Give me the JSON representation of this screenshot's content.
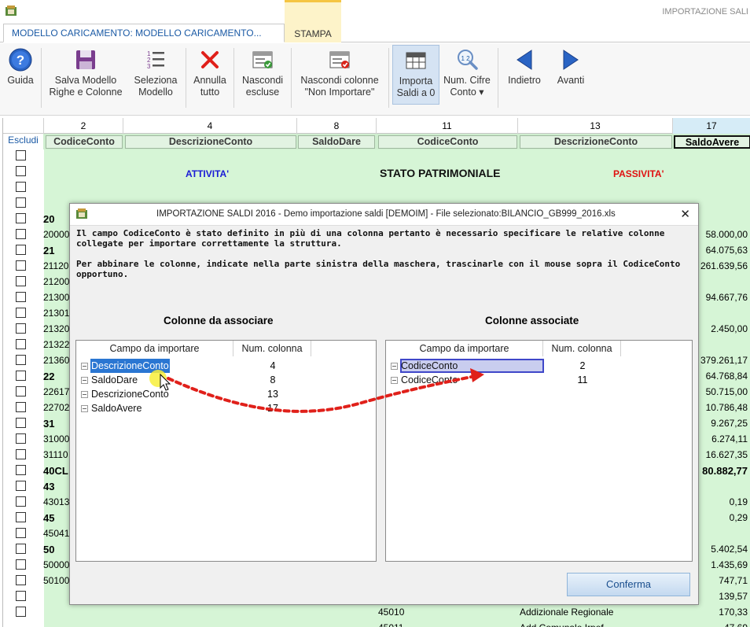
{
  "window": {
    "title": "IMPORTAZIONE SALI"
  },
  "tabs": [
    {
      "label": "MODELLO CARICAMENTO: MODELLO CARICAMENTO..."
    },
    {
      "label": "STAMPA"
    }
  ],
  "ribbon": {
    "buttons": [
      {
        "label": "Guida",
        "icon": "help-icon"
      },
      {
        "label": "Salva Modello\nRighe e Colonne",
        "icon": "save-icon"
      },
      {
        "label": "Seleziona\nModello",
        "icon": "list-icon"
      },
      {
        "label": "Annulla\ntutto",
        "icon": "cancel-icon"
      },
      {
        "label": "Nascondi\nescluse",
        "icon": "hide-icon"
      },
      {
        "label": "Nascondi colonne\n\"Non Importare\"",
        "icon": "hide-columns-icon"
      },
      {
        "label": "Importa\nSaldi a 0",
        "icon": "table-icon"
      },
      {
        "label": "Num. Cifre\nConto ▾",
        "icon": "zoom-icon"
      },
      {
        "label": "Indietro",
        "icon": "arrow-left-icon"
      },
      {
        "label": "Avanti",
        "icon": "arrow-right-icon"
      }
    ]
  },
  "grid": {
    "escludi_label": "Escludi",
    "column_numbers": [
      "2",
      "4",
      "8",
      "11",
      "13",
      "17"
    ],
    "column_names": [
      "CodiceConto",
      "DescrizioneConto",
      "SaldoDare",
      "CodiceConto",
      "DescrizioneConto",
      "SaldoAvere"
    ],
    "banner": {
      "attivita": "ATTIVITA'",
      "stato": "STATO PATRIMONIALE",
      "passivita": "PASSIVITA'"
    },
    "row_codes": [
      "20",
      "20000",
      "21",
      "21120",
      "21200",
      "21300",
      "21301",
      "21320",
      "21322",
      "21360",
      "22",
      "22617",
      "22702",
      "31",
      "31000",
      "31110",
      "40CL",
      "43",
      "43013",
      "45",
      "45041",
      "50",
      "50000",
      "50100"
    ],
    "row_values": [
      "58.000,00",
      "64.075,63",
      "261.639,56",
      "94.667,76",
      "2.450,00",
      "379.261,17",
      "64.768,84",
      "50.715,00",
      "10.786,48",
      "9.267,25",
      "6.274,11",
      "16.627,35",
      "80.882,77",
      "0,19",
      "0,29",
      "5.402,54",
      "1.435,69",
      "747,71",
      "139,57",
      "170,33",
      "47,69"
    ],
    "bottom_row": {
      "code": "45010",
      "description": "Addizionale Regionale",
      "value": "170,33"
    },
    "last_row": {
      "code": "45011",
      "description": "Add.Comunale Irpef"
    }
  },
  "dialog": {
    "title": "IMPORTAZIONE SALDI 2016 - Demo importazione saldi [DEMOIM] - File selezionato:BILANCIO_GB999_2016.xls",
    "close_glyph": "✕",
    "message_1a": "Il campo CodiceConto è stato definito in più di una colonna pertanto è necessario specificare le relative colonne",
    "message_1b": "collegate per importare correttamente la struttura.",
    "message_2a": "Per abbinare le colonne, indicate nella parte sinistra della maschera,  trascinarle con il mouse sopra il CodiceConto",
    "message_2b": "opportuno.",
    "left_title": "Colonne da associare",
    "right_title": "Colonne associate",
    "hdr_field": "Campo da importare",
    "hdr_col": "Num. colonna",
    "left_rows": [
      {
        "field": "DescrizioneConto",
        "col": "4"
      },
      {
        "field": "SaldoDare",
        "col": "8"
      },
      {
        "field": "DescrizioneConto",
        "col": "13"
      },
      {
        "field": "SaldoAvere",
        "col": "17"
      }
    ],
    "right_rows": [
      {
        "field": "CodiceConto",
        "col": "2"
      },
      {
        "field": "CodiceConto",
        "col": "11"
      }
    ],
    "confirm_label": "Conferma"
  },
  "colors": {
    "accent": "#1b5aa5",
    "grid_green": "#d6f5d6",
    "highlight": "#2a76d2",
    "drag_arrow": "#e0201a",
    "attivita": "#1a1ad6",
    "passivita": "#e01010"
  }
}
